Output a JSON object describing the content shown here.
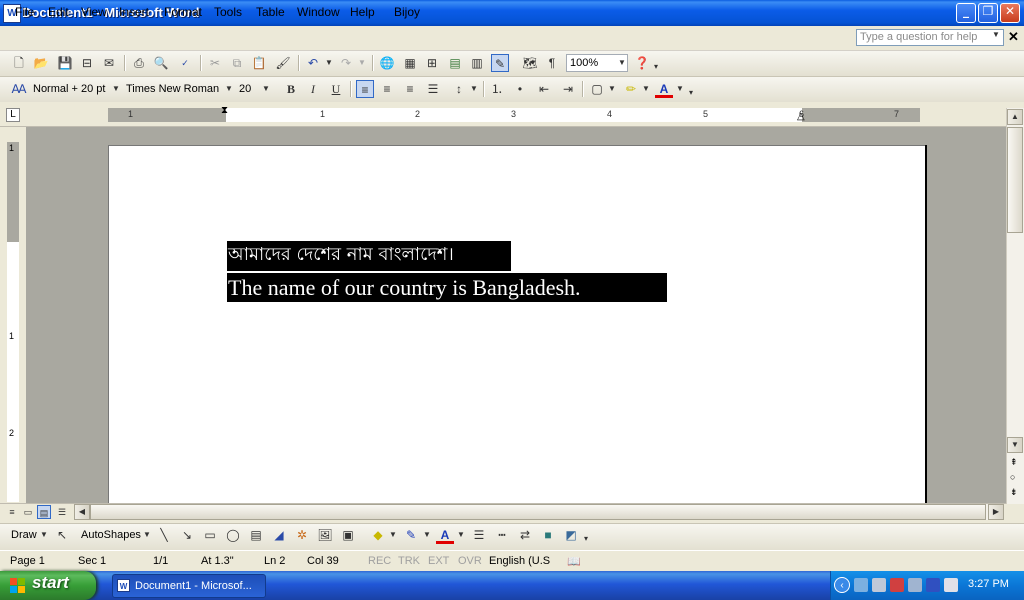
{
  "window": {
    "title": "Document1 - Microsoft Word",
    "app_icon": "W",
    "controls": [
      "minimize-icon",
      "restore-icon",
      "close-icon"
    ]
  },
  "menu": {
    "items": [
      "File",
      "Edit",
      "View",
      "Insert",
      "Format",
      "Tools",
      "Table",
      "Window",
      "Help",
      "Bijoy"
    ],
    "help_placeholder": "Type a question for help"
  },
  "standard_toolbar": {
    "zoom": "100%"
  },
  "formatting_toolbar": {
    "style": "Normal + 20 pt",
    "font": "Times New Roman",
    "size": "20",
    "bold_label": "B",
    "italic_label": "I",
    "underline_label": "U",
    "font_color_label": "A"
  },
  "ruler": {
    "numbers": [
      "1",
      "1",
      "2",
      "3",
      "4",
      "5",
      "6",
      "7"
    ],
    "vertical_numbers": [
      "1",
      "1",
      "2"
    ],
    "tab_selector": "L"
  },
  "document": {
    "lines": [
      "আমাদের দেশের নাম বাংলাদেশ।",
      "The name of our country is Bangladesh."
    ]
  },
  "draw_toolbar": {
    "draw_label": "Draw",
    "autoshapes_label": "AutoShapes"
  },
  "status": {
    "page": "Page 1",
    "sec": "Sec 1",
    "pages": "1/1",
    "at": "At 1.3\"",
    "ln": "Ln 2",
    "col": "Col 39",
    "rec": "REC",
    "trk": "TRK",
    "ext": "EXT",
    "ovr": "OVR",
    "language": "English (U.S"
  },
  "taskbar": {
    "start_label": "start",
    "task_label": "Document1 - Microsof...",
    "clock": "3:27 PM"
  }
}
